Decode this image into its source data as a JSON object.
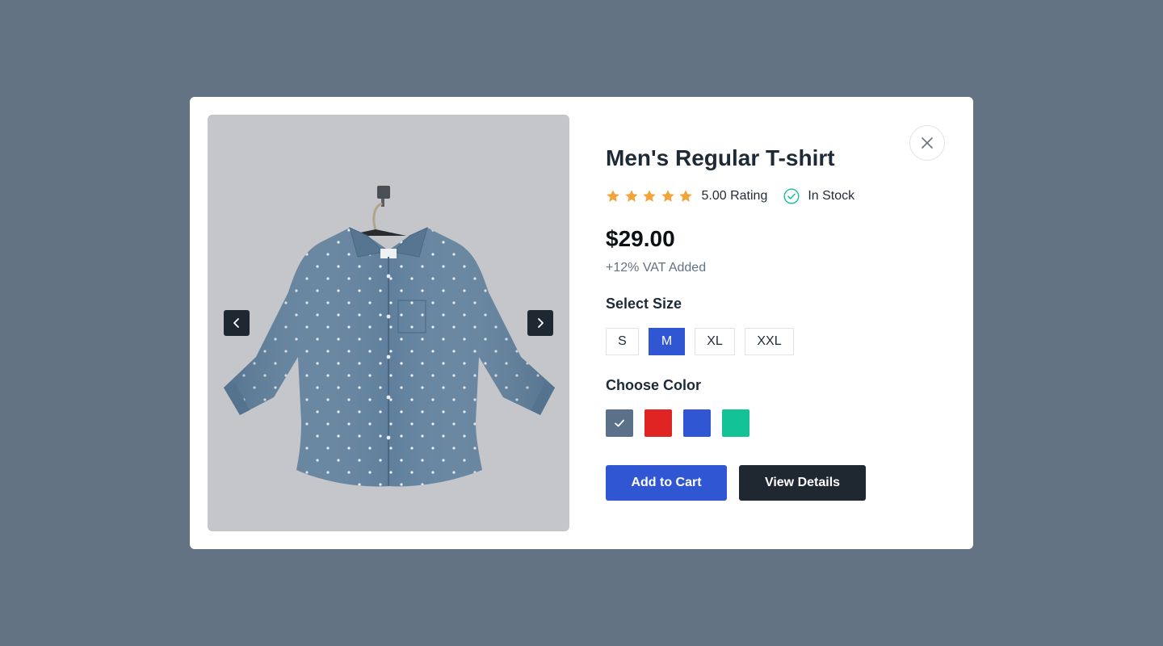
{
  "product": {
    "title": "Men's Regular T-shirt",
    "rating": 5.0,
    "rating_text": "5.00 Rating",
    "stock_text": "In Stock",
    "price": "$29.00",
    "vat_note": "+12% VAT Added"
  },
  "size_section": {
    "label": "Select Size",
    "options": [
      "S",
      "M",
      "XL",
      "XXL"
    ],
    "selected": "M"
  },
  "color_section": {
    "label": "Choose Color",
    "options": [
      "#5a7189",
      "#e02424",
      "#3056d3",
      "#13c296"
    ],
    "selected_index": 0
  },
  "actions": {
    "add_to_cart": "Add to Cart",
    "view_details": "View Details"
  },
  "icons": {
    "close": "close-icon",
    "prev": "chevron-left-icon",
    "next": "chevron-right-icon",
    "star": "star-icon",
    "stock": "check-circle-icon"
  },
  "colors": {
    "backdrop": "#647384",
    "primary": "#3056d3",
    "dark": "#1f2731",
    "star": "#f2a33a",
    "stock": "#13c296"
  }
}
